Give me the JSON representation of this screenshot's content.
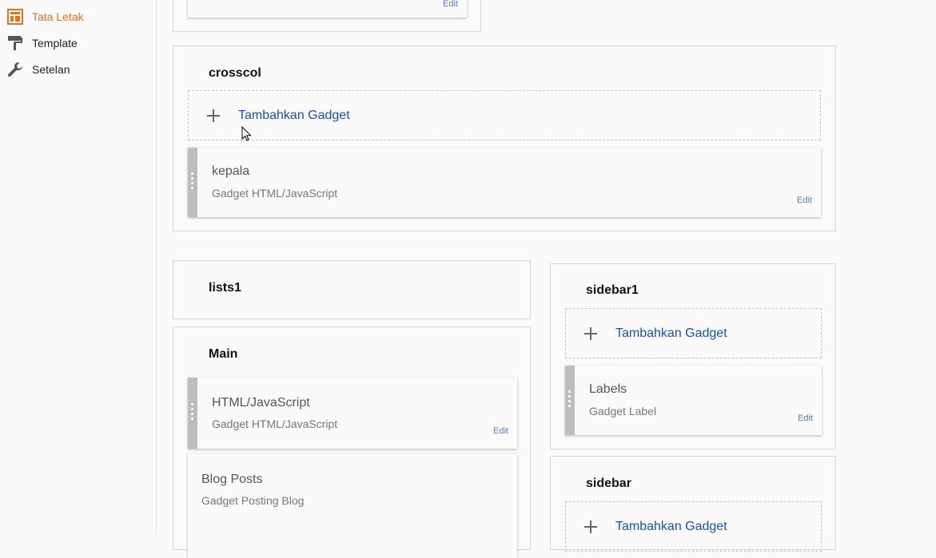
{
  "nav": {
    "items": [
      {
        "label": "Tata Letak",
        "icon": "layout-icon",
        "active": true
      },
      {
        "label": "Template",
        "icon": "paint-roller-icon",
        "active": false
      },
      {
        "label": "Setelan",
        "icon": "wrench-icon",
        "active": false
      }
    ]
  },
  "colors": {
    "accent": "#e8711c",
    "link": "#1a4fb4",
    "edit": "#5a7ac7"
  },
  "top_section": {
    "edit_label": "Edit"
  },
  "crosscol": {
    "title": "crosscol",
    "add_label": "Tambahkan Gadget",
    "gadgets": [
      {
        "name": "kepala",
        "type": "Gadget HTML/JavaScript",
        "edit_label": "Edit"
      }
    ]
  },
  "lists1": {
    "title": "lists1"
  },
  "main": {
    "title": "Main",
    "gadgets": [
      {
        "name": "HTML/JavaScript",
        "type": "Gadget HTML/JavaScript",
        "edit_label": "Edit"
      },
      {
        "name": "Blog Posts",
        "type": "Gadget Posting Blog"
      }
    ]
  },
  "sidebar1": {
    "title": "sidebar1",
    "add_label": "Tambahkan Gadget",
    "gadgets": [
      {
        "name": "Labels",
        "type": "Gadget Label",
        "edit_label": "Edit"
      }
    ]
  },
  "sidebar": {
    "title": "sidebar",
    "add_label": "Tambahkan Gadget"
  }
}
